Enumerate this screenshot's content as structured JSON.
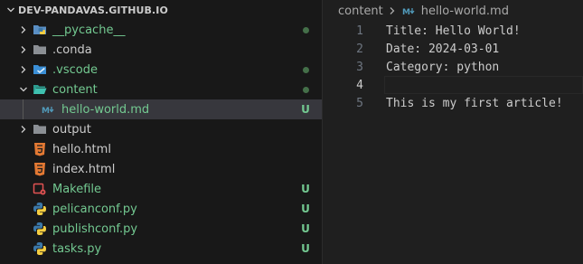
{
  "explorer": {
    "root_label": "DEV-PANDAVAS.GITHUB.IO",
    "items": [
      {
        "label": "__pycache__",
        "deco": ""
      },
      {
        "label": ".conda",
        "deco": ""
      },
      {
        "label": ".vscode",
        "deco": ""
      },
      {
        "label": "content",
        "deco": ""
      },
      {
        "label": "hello-world.md",
        "deco": "U"
      },
      {
        "label": "output",
        "deco": ""
      },
      {
        "label": "hello.html",
        "deco": ""
      },
      {
        "label": "index.html",
        "deco": ""
      },
      {
        "label": "Makefile",
        "deco": "U"
      },
      {
        "label": "pelicanconf.py",
        "deco": "U"
      },
      {
        "label": "publishconf.py",
        "deco": "U"
      },
      {
        "label": "tasks.py",
        "deco": "U"
      }
    ]
  },
  "editor": {
    "breadcrumb": {
      "folder": "content",
      "file": "hello-world.md"
    },
    "lines": [
      {
        "num": "1",
        "text": "Title: Hello World!"
      },
      {
        "num": "2",
        "text": "Date: 2024-03-01"
      },
      {
        "num": "3",
        "text": "Category: python"
      },
      {
        "num": "4",
        "text": ""
      },
      {
        "num": "5",
        "text": "This is my first article!"
      }
    ]
  },
  "colors": {
    "untracked": "#73c991",
    "modified_dot": "#446f49",
    "selected_row": "#37373d",
    "html_icon": "#e37933",
    "python_blue": "#3b77a8",
    "python_yellow": "#f5cd41",
    "markdown_icon": "#519aba"
  }
}
